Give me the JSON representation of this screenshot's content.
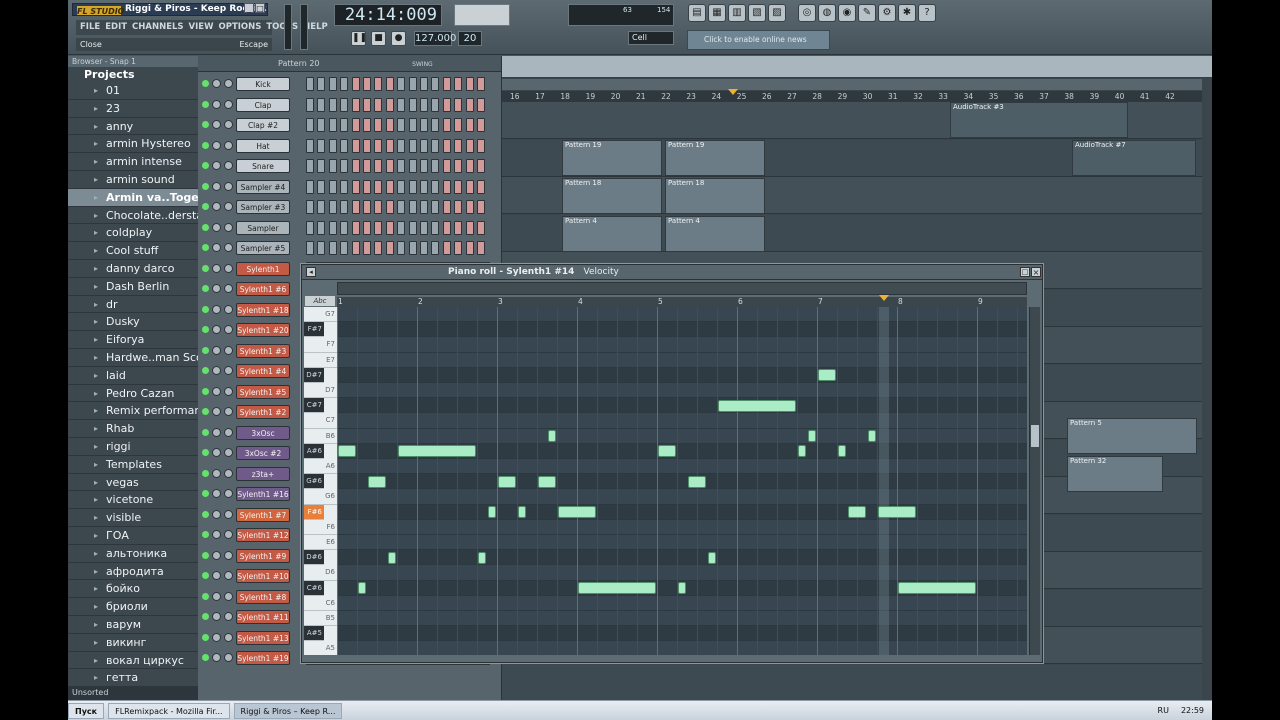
{
  "app": {
    "logo": "FL STUDIO",
    "title": "Riggi & Piros - Keep Rockin.flp",
    "menu": [
      "FILE",
      "EDIT",
      "CHANNELS",
      "VIEW",
      "OPTIONS",
      "TOOLS",
      "HELP"
    ],
    "hint_left": "Close",
    "hint_right": "Escape",
    "time_display": "24:14:009",
    "tempo": "127.000",
    "pattern_num": "20",
    "snap": "Cell",
    "online_text": "Click to enable online news",
    "cpu": "63",
    "poly": "154"
  },
  "browser": {
    "header": "Browser - Snap 1",
    "root": "Projects",
    "items": [
      "01",
      "23",
      "anny",
      "armin Hystereo",
      "armin intense",
      "armin sound",
      "Armin va..Together",
      "Chocolate..derstand",
      "coldplay",
      "Cool stuff",
      "danny darco",
      "Dash Berlin",
      "dr",
      "Dusky",
      "Eiforya",
      "Hardwe..man Scoop",
      "laid",
      "Pedro Cazan",
      "Remix performance",
      "Rhab",
      "riggi",
      "Templates",
      "vegas",
      "vicetone",
      "visible",
      "ГОА",
      "альтоника",
      "афродита",
      "бойко",
      "бриоли",
      "варум",
      "викинг",
      "вокал циркус",
      "гетта"
    ],
    "selected_index": 6,
    "footer": "Unsorted"
  },
  "rack": {
    "pattern_label": "Pattern 20",
    "swing_label": "SWING",
    "channels": [
      {
        "name": "Kick",
        "color": "#c8d0d5"
      },
      {
        "name": "Clap",
        "color": "#c8d0d5"
      },
      {
        "name": "Clap #2",
        "color": "#c8d0d5"
      },
      {
        "name": "Hat",
        "color": "#c8d0d5"
      },
      {
        "name": "Snare",
        "color": "#c8d0d5"
      },
      {
        "name": "Sampler #4",
        "color": "#aab4ba"
      },
      {
        "name": "Sampler #3",
        "color": "#aab4ba"
      },
      {
        "name": "Sampler",
        "color": "#aab4ba"
      },
      {
        "name": "Sampler #5",
        "color": "#aab4ba"
      },
      {
        "name": "Sylenth1",
        "color": "#c25a46"
      },
      {
        "name": "Sylenth1 #6",
        "color": "#c25a46"
      },
      {
        "name": "Sylenth1 #18",
        "color": "#c25a46"
      },
      {
        "name": "Sylenth1 #20",
        "color": "#c25a46"
      },
      {
        "name": "Sylenth1 #3",
        "color": "#c25a46"
      },
      {
        "name": "Sylenth1 #4",
        "color": "#c25a46"
      },
      {
        "name": "Sylenth1 #5",
        "color": "#c25a46"
      },
      {
        "name": "Sylenth1 #2",
        "color": "#c25a46"
      },
      {
        "name": "3xOsc",
        "color": "#6f5a8a"
      },
      {
        "name": "3xOsc #2",
        "color": "#6f5a8a"
      },
      {
        "name": "z3ta+",
        "color": "#6f5a8a"
      },
      {
        "name": "Sylenth1 #16",
        "color": "#6f5a8a"
      },
      {
        "name": "Sylenth1 #7",
        "color": "#d0653e"
      },
      {
        "name": "Sylenth1 #12",
        "color": "#c25a46"
      },
      {
        "name": "Sylenth1 #9",
        "color": "#c25a46"
      },
      {
        "name": "Sylenth1 #10",
        "color": "#c25a46"
      },
      {
        "name": "Sylenth1 #8",
        "color": "#c25a46"
      },
      {
        "name": "Sylenth1 #11",
        "color": "#c25a46"
      },
      {
        "name": "Sylenth1 #13",
        "color": "#c25a46"
      },
      {
        "name": "Sylenth1 #19",
        "color": "#c25a46"
      }
    ]
  },
  "playlist": {
    "bars": [
      "16",
      "17",
      "18",
      "19",
      "20",
      "21",
      "22",
      "23",
      "24",
      "25",
      "26",
      "27",
      "28",
      "29",
      "30",
      "31",
      "32",
      "33",
      "34",
      "35",
      "36",
      "37",
      "38",
      "39",
      "40",
      "41",
      "42"
    ],
    "clips": [
      {
        "label": "Pattern 19"
      },
      {
        "label": "Pattern 19"
      },
      {
        "label": "Pattern 18"
      },
      {
        "label": "Pattern 18"
      },
      {
        "label": "Pattern 4"
      },
      {
        "label": "Pattern 4"
      },
      {
        "label": "AudioTrack #3"
      },
      {
        "label": "AudioTrack #7"
      },
      {
        "label": "Pattern 5"
      },
      {
        "label": "Pattern 32"
      }
    ]
  },
  "piano_roll": {
    "title": "Piano roll - Sylenth1 #14",
    "mode": "Velocity",
    "bars": [
      "1",
      "2",
      "3",
      "4",
      "5",
      "6",
      "7",
      "8",
      "9"
    ],
    "keys": [
      "G7",
      "F#7",
      "F7",
      "E7",
      "D#7",
      "D7",
      "C#7",
      "C7",
      "B6",
      "A#6",
      "A6",
      "G#6",
      "G6",
      "F#6",
      "F6",
      "E6",
      "D#6",
      "D6",
      "C#6",
      "C6",
      "B5",
      "A#5",
      "A5"
    ],
    "notes": [
      {
        "pitch": "A#6",
        "start": 0.0,
        "len": 0.25
      },
      {
        "pitch": "A#6",
        "start": 0.75,
        "len": 1.0
      },
      {
        "pitch": "G#6",
        "start": 0.375,
        "len": 0.25
      },
      {
        "pitch": "D#6",
        "start": 0.625,
        "len": 0.125
      },
      {
        "pitch": "C#6",
        "start": 0.25,
        "len": 0.125
      },
      {
        "pitch": "G#6",
        "start": 2.0,
        "len": 0.25
      },
      {
        "pitch": "G#6",
        "start": 2.5,
        "len": 0.25
      },
      {
        "pitch": "F#6",
        "start": 1.875,
        "len": 0.125
      },
      {
        "pitch": "F#6",
        "start": 2.25,
        "len": 0.125
      },
      {
        "pitch": "D#6",
        "start": 1.75,
        "len": 0.125
      },
      {
        "pitch": "B6",
        "start": 2.625,
        "len": 0.125
      },
      {
        "pitch": "F#6",
        "start": 2.75,
        "len": 0.5
      },
      {
        "pitch": "C#6",
        "start": 3.0,
        "len": 1.0
      },
      {
        "pitch": "A#6",
        "start": 4.0,
        "len": 0.25
      },
      {
        "pitch": "G#6",
        "start": 4.375,
        "len": 0.25
      },
      {
        "pitch": "C#6",
        "start": 4.25,
        "len": 0.125
      },
      {
        "pitch": "D#6",
        "start": 4.625,
        "len": 0.125
      },
      {
        "pitch": "C#7",
        "start": 4.75,
        "len": 1.0
      },
      {
        "pitch": "D#7",
        "start": 6.0,
        "len": 0.25
      },
      {
        "pitch": "A#6",
        "start": 5.75,
        "len": 0.125
      },
      {
        "pitch": "B6",
        "start": 5.875,
        "len": 0.125
      },
      {
        "pitch": "A#6",
        "start": 6.25,
        "len": 0.125
      },
      {
        "pitch": "B6",
        "start": 6.625,
        "len": 0.125
      },
      {
        "pitch": "F#6",
        "start": 6.375,
        "len": 0.25
      },
      {
        "pitch": "F#6",
        "start": 6.75,
        "len": 0.5
      },
      {
        "pitch": "C#6",
        "start": 7.0,
        "len": 1.0
      }
    ]
  },
  "taskbar": {
    "start": "Пуск",
    "tasks": [
      "FLRemixpack - Mozilla Fir...",
      "Riggi & Piros – Keep R..."
    ],
    "lang": "RU",
    "clock": "22:59"
  }
}
